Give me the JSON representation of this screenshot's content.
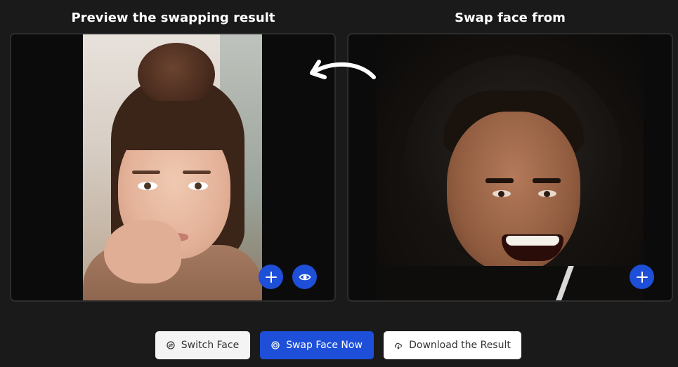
{
  "preview_panel": {
    "title": "Preview the swapping result"
  },
  "source_panel": {
    "title": "Swap face from"
  },
  "overlay_buttons": {
    "add_icon": "plus-icon",
    "view_icon": "eye-icon",
    "color": "#1e4fd8"
  },
  "arrow": {
    "icon": "curved-arrow-left-icon",
    "color": "#ffffff"
  },
  "actions": {
    "switch_label": "Switch Face",
    "switch_icon": "switch-icon",
    "swap_label": "Swap Face Now",
    "swap_icon": "target-icon",
    "download_label": "Download the Result",
    "download_icon": "cloud-download-icon"
  },
  "colors": {
    "background": "#1a1a1a",
    "accent": "#1e4fd8",
    "panel_border": "#2d2d2d"
  }
}
